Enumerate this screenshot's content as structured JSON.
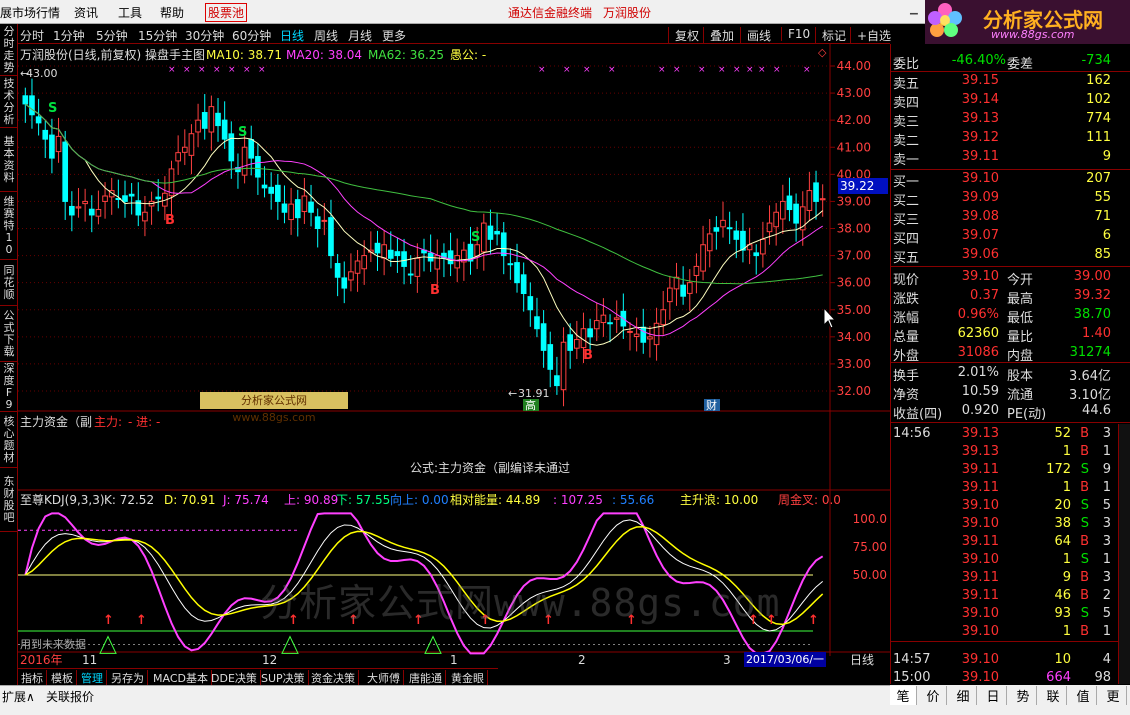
{
  "menu": {
    "items": [
      "展市场行情",
      "资讯",
      "工具",
      "帮助",
      "股票池"
    ],
    "center_links": [
      "通达信金融终端",
      "万润股份"
    ]
  },
  "logo": {
    "brand": "分析家公式网",
    "url": "www.88gs.com",
    "stock_hint": "万润股份"
  },
  "periods": {
    "items": [
      "分时",
      "1分钟",
      "5分钟",
      "15分钟",
      "30分钟",
      "60分钟",
      "日线",
      "周线",
      "月线",
      "更多"
    ],
    "selected": "日线",
    "right_buttons": [
      "复权",
      "叠加",
      "画线",
      "F10",
      "标记",
      "+自选"
    ]
  },
  "left_tabs": [
    "分时走势",
    "技术分析",
    "基本资料",
    "维赛特10",
    "同花顺",
    "公式下载",
    "深度F9",
    "核心题材",
    "东财股吧"
  ],
  "main_chart": {
    "legend": {
      "title": "万润股份(日线,前复权) 操盘手主图",
      "ma10": "MA10: 38.71",
      "ma20": "MA20: 38.04",
      "ma62": "MA62: 36.25",
      "extra": "愚公: -"
    },
    "high_label": "43.00",
    "low_label": "31.91",
    "y_ticks": [
      "44.00",
      "43.00",
      "42.00",
      "41.00",
      "40.00",
      "39.00",
      "38.00",
      "37.00",
      "36.00",
      "35.00",
      "34.00",
      "33.00",
      "32.00"
    ],
    "last_price": "39.22",
    "marks": [
      {
        "text": "S",
        "type": "sell"
      },
      {
        "text": "B",
        "type": "buy"
      },
      {
        "text": "S",
        "type": "sell"
      },
      {
        "text": "B",
        "type": "buy"
      },
      {
        "text": "S",
        "type": "sell"
      },
      {
        "text": "B",
        "type": "buy"
      }
    ],
    "badges": [
      "高",
      "财"
    ],
    "watermark_box": "分析家公式网www.88gs.com",
    "colors": {
      "up": "#ff4040",
      "down": "#00ffff",
      "ma10": "#ffffff",
      "ma20": "#ff40ff",
      "ma62": "#40c040"
    }
  },
  "sub1": {
    "title": "主力资金（副",
    "title_red": "主力:",
    "title_red2": "- 进: -",
    "message": "公式:主力资金（副编译未通过"
  },
  "kdj": {
    "name": "至尊KDJ(9,3,3)",
    "k": "K: 72.52",
    "d": "D: 70.91",
    "j": "J: 75.74",
    "up": "上: 90.89",
    "down": "下: 57.55",
    "xiangshang": "向上: 0.00",
    "relative_energy": "相对能量: 44.89",
    "v1": ": 107.25",
    "v2": ": 55.66",
    "main_wave": "主升浪: 10.00",
    "golden": "周金叉: 0.0",
    "y_ticks": [
      "100.0",
      "75.00",
      "50.00"
    ]
  },
  "watermark_text": "分析家公式网www.88gs.com",
  "x_axis": {
    "labels": [
      "2016年",
      "11",
      "12",
      "1",
      "2",
      "3"
    ],
    "date": "2017/03/06/一",
    "period": "日线"
  },
  "bottom_tabs": [
    "指标",
    "模板",
    "管理",
    "另存为",
    "MACD基本",
    "DDE决策",
    "SUP决策",
    "资金决策",
    "大师傅",
    "唐能通",
    "黄金眼"
  ],
  "bottom_selected": "管理",
  "status": {
    "left": "扩展∧",
    "left2": "关联报价",
    "extra": "用到未来数据"
  },
  "quote": {
    "weibi": {
      "label": "委比",
      "value": "-46.40%",
      "label2": "委差",
      "value2": "-734"
    },
    "sell": [
      {
        "label": "卖五",
        "price": "39.15",
        "vol": "162"
      },
      {
        "label": "卖四",
        "price": "39.14",
        "vol": "102"
      },
      {
        "label": "卖三",
        "price": "39.13",
        "vol": "774"
      },
      {
        "label": "卖二",
        "price": "39.12",
        "vol": "111"
      },
      {
        "label": "卖一",
        "price": "39.11",
        "vol": "9"
      }
    ],
    "buy": [
      {
        "label": "买一",
        "price": "39.10",
        "vol": "207"
      },
      {
        "label": "买二",
        "price": "39.09",
        "vol": "55"
      },
      {
        "label": "买三",
        "price": "39.08",
        "vol": "71"
      },
      {
        "label": "买四",
        "price": "39.07",
        "vol": "6"
      },
      {
        "label": "买五",
        "price": "39.06",
        "vol": "85"
      }
    ],
    "stats1": [
      {
        "l1": "现价",
        "v1": "39.10",
        "c1": "red",
        "l2": "今开",
        "v2": "39.00",
        "c2": "red"
      },
      {
        "l1": "涨跌",
        "v1": "0.37",
        "c1": "red",
        "l2": "最高",
        "v2": "39.32",
        "c2": "red"
      },
      {
        "l1": "涨幅",
        "v1": "0.96%",
        "c1": "red",
        "l2": "最低",
        "v2": "38.70",
        "c2": "grn"
      },
      {
        "l1": "总量",
        "v1": "62360",
        "c1": "yel",
        "l2": "量比",
        "v2": "1.40",
        "c2": "red"
      },
      {
        "l1": "外盘",
        "v1": "31086",
        "c1": "red",
        "l2": "内盘",
        "v2": "31274",
        "c2": "grn"
      }
    ],
    "stats2": [
      {
        "l1": "换手",
        "v1": "2.01%",
        "l2": "股本",
        "v2": "3.64亿"
      },
      {
        "l1": "净资",
        "v1": "10.59",
        "l2": "流通",
        "v2": "3.10亿"
      },
      {
        "l1": "收益(四)",
        "v1": "0.920",
        "l2": "PE(动)",
        "v2": "44.6"
      }
    ],
    "ticks": [
      {
        "time": "14:56",
        "price": "39.13",
        "vol": "52",
        "bs": "B",
        "n": "3"
      },
      {
        "time": "",
        "price": "39.13",
        "vol": "1",
        "bs": "B",
        "n": "1"
      },
      {
        "time": "",
        "price": "39.11",
        "vol": "172",
        "bs": "S",
        "n": "9"
      },
      {
        "time": "",
        "price": "39.11",
        "vol": "1",
        "bs": "B",
        "n": "1"
      },
      {
        "time": "",
        "price": "39.10",
        "vol": "20",
        "bs": "S",
        "n": "5"
      },
      {
        "time": "",
        "price": "39.10",
        "vol": "38",
        "bs": "S",
        "n": "3"
      },
      {
        "time": "",
        "price": "39.11",
        "vol": "64",
        "bs": "B",
        "n": "3"
      },
      {
        "time": "",
        "price": "39.10",
        "vol": "1",
        "bs": "S",
        "n": "1"
      },
      {
        "time": "",
        "price": "39.11",
        "vol": "9",
        "bs": "B",
        "n": "3"
      },
      {
        "time": "",
        "price": "39.11",
        "vol": "46",
        "bs": "B",
        "n": "2"
      },
      {
        "time": "",
        "price": "39.10",
        "vol": "93",
        "bs": "S",
        "n": "5"
      },
      {
        "time": "",
        "price": "39.10",
        "vol": "1",
        "bs": "B",
        "n": "1"
      },
      {
        "time": "14:57",
        "price": "39.10",
        "vol": "10",
        "bs": "",
        "n": "4"
      },
      {
        "time": "15:00",
        "price": "39.10",
        "vol": "664",
        "bs": "",
        "n": "98"
      }
    ],
    "tabs": [
      "笔",
      "价",
      "细",
      "日",
      "势",
      "联",
      "值",
      "更"
    ]
  }
}
